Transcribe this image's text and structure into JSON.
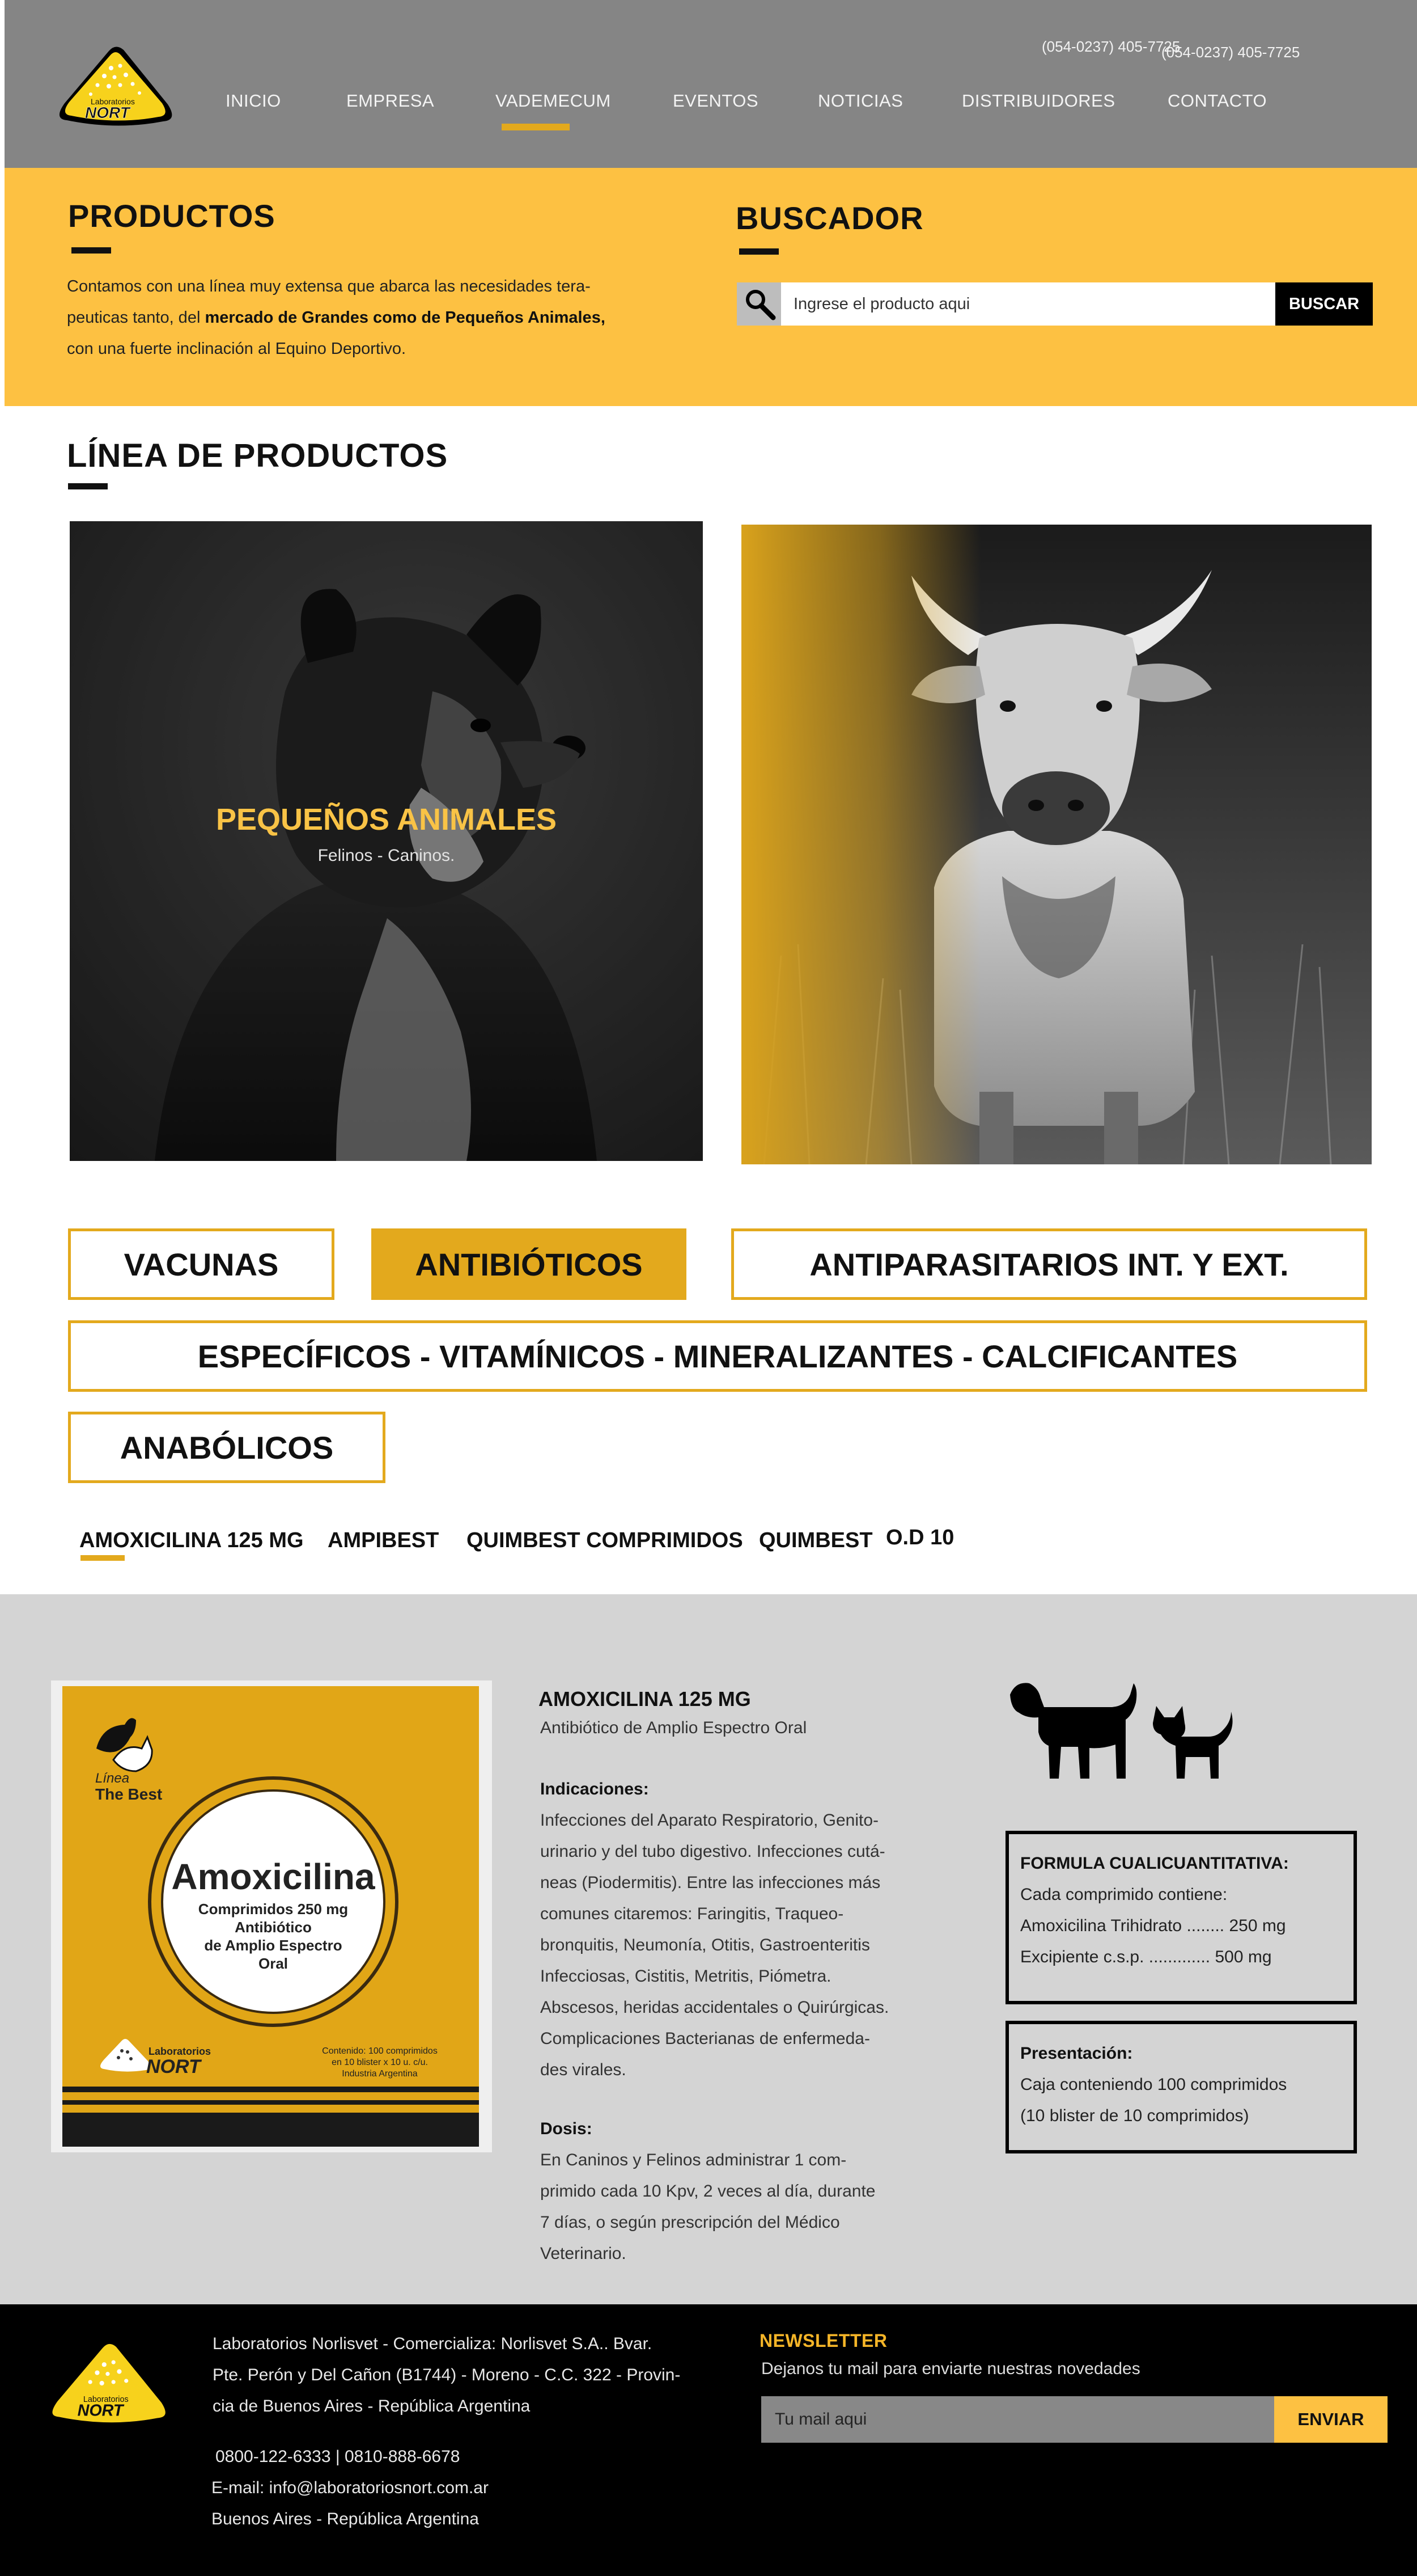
{
  "header": {
    "logo_text_top": "Laboratorios",
    "logo_text_bottom": "NORT",
    "phone_1": "(054-0237) 405-7725",
    "phone_2": "(054-0237) 405-7725",
    "nav": [
      {
        "label": "INICIO"
      },
      {
        "label": "EMPRESA"
      },
      {
        "label": "VADEMECUM",
        "active": true
      },
      {
        "label": "EVENTOS"
      },
      {
        "label": "NOTICIAS"
      },
      {
        "label": "DISTRIBUIDORES"
      },
      {
        "label": "CONTACTO"
      }
    ]
  },
  "productos": {
    "title": "PRODUCTOS",
    "text_1": "Contamos con una línea muy  extensa que abarca las necesidades tera-",
    "text_2a": "peuticas tanto, del ",
    "text_2b": "mercado de Grandes como de Pequeños Animales,",
    "text_3": "con una fuerte inclinación al Equino Deportivo."
  },
  "buscador": {
    "title": "BUSCADOR",
    "placeholder": "Ingrese el producto aqui",
    "button": "BUSCAR"
  },
  "linea": {
    "title": "LÍNEA DE PRODUCTOS",
    "card_small_title": "PEQUEÑOS ANIMALES",
    "card_small_sub": "Felinos - Caninos."
  },
  "categories": {
    "vacunas": "VACUNAS",
    "antibioticos": "ANTIBIÓTICOS",
    "antiparasitarios": "ANTIPARASITARIOS INT. Y EXT.",
    "especificos": "ESPECÍFICOS - VITAMÍNICOS - MINERALIZANTES - CALCIFICANTES",
    "anabolicos": "ANABÓLICOS"
  },
  "subtabs": [
    "AMOXICILINA 125 MG",
    "AMPIBEST",
    "QUIMBEST COMPRIMIDOS",
    "QUIMBEST",
    "O.D 10"
  ],
  "product": {
    "box_line": "Línea",
    "box_brand": "The Best",
    "box_name": "Amoxicilina",
    "box_line1": "Comprimidos  250 mg",
    "box_line2": "Antibiótico",
    "box_line3": "de Amplio Espectro",
    "box_line4": "Oral",
    "box_lab_top": "Laboratorios",
    "box_lab_bottom": "NORT",
    "box_content_1": "Contenido: 100 comprimidos",
    "box_content_2": "en 10 blister x 10 u. c/u.",
    "box_content_3": "Industria Argentina",
    "name": "AMOXICILINA 125 MG",
    "subtitle": "Antibiótico de Amplio Espectro Oral",
    "ind_label": "Indicaciones:",
    "ind_lines": [
      "Infecciones del Aparato Respiratorio, Genito-",
      "urinario y del tubo digestivo. Infecciones cutá-",
      "neas (Piodermitis). Entre las infecciones más",
      "comunes citaremos: Faringitis, Traqueo-",
      "bronquitis, Neumonía, Otitis, Gastroenteritis",
      "Infecciosas, Cistitis, Metritis, Piómetra.",
      "Abscesos, heridas accidentales o Quirúrgicas.",
      "Complicaciones Bacterianas de enfermeda-",
      "des virales."
    ],
    "dosis_label": "Dosis:",
    "dosis_lines": [
      "En Caninos y Felinos administrar 1 com-",
      "primido cada 10 Kpv, 2 veces al día, durante",
      "7 días, o según prescripción del Médico",
      "Veterinario."
    ],
    "formula_label": "FORMULA CUALICUANTITATIVA:",
    "formula_lines": [
      "Cada comprimido contiene:",
      "Amoxicilina Trihidrato ........ 250 mg",
      "Excipiente c.s.p. ............. 500 mg"
    ],
    "presentacion_label": "Presentación:",
    "presentacion_lines": [
      "Caja conteniendo 100 comprimidos",
      "(10 blister de 10 comprimidos)"
    ]
  },
  "footer": {
    "logo_text_top": "Laboratorios",
    "logo_text_bottom": "NORT",
    "address_lines": [
      "Laboratorios Norlisvet - Comercializa: Norlisvet S.A.. Bvar.",
      "Pte. Perón y Del Cañon (B1744) - Moreno - C.C. 322 - Provin-",
      "cia de Buenos Aires - República Argentina"
    ],
    "phones": "0800-122-6333 | 0810-888-6678",
    "email": "E-mail: info@laboratoriosnort.com.ar",
    "city": "Buenos Aires - República Argentina",
    "newsletter_title": "NEWSLETTER",
    "newsletter_sub": "Dejanos tu mail para enviarte nuestras novedades",
    "newsletter_placeholder": "Tu mail aqui",
    "newsletter_button": "ENVIAR"
  },
  "colors": {
    "accent": "#e3a91d",
    "yellow": "#fdc142",
    "header_gray": "#858585",
    "detail_gray": "#d4d4d4"
  }
}
